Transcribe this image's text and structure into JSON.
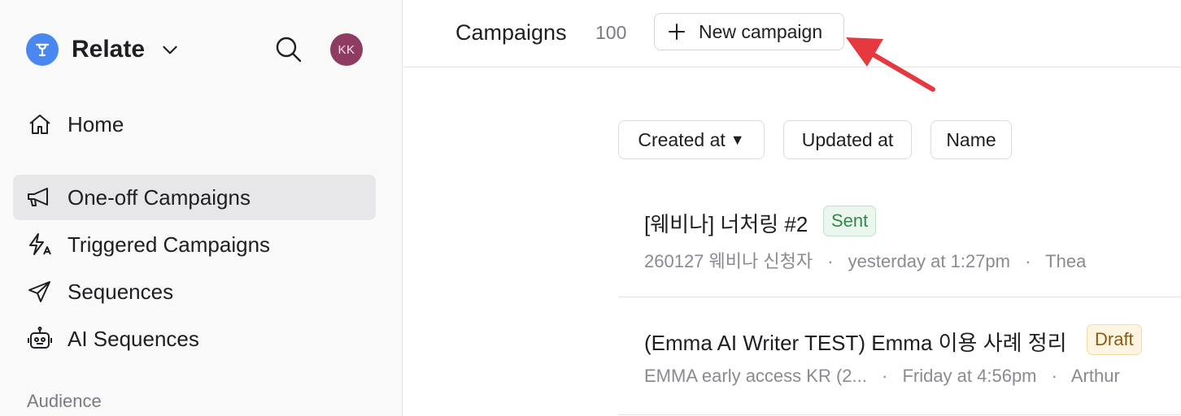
{
  "workspace": {
    "name": "Relate",
    "logo_color": "#4b87f0"
  },
  "user": {
    "initials": "KK",
    "avatar_color": "#8f3c63"
  },
  "sidebar": {
    "items": [
      {
        "label": "Home",
        "icon": "home-icon",
        "active": false
      },
      {
        "label": "One-off Campaigns",
        "icon": "megaphone-icon",
        "active": true
      },
      {
        "label": "Triggered Campaigns",
        "icon": "bolt-icon",
        "active": false
      },
      {
        "label": "Sequences",
        "icon": "paper-plane-icon",
        "active": false
      },
      {
        "label": "AI Sequences",
        "icon": "robot-icon",
        "active": false
      }
    ],
    "section_label": "Audience"
  },
  "header": {
    "title": "Campaigns",
    "count": "100",
    "new_button_label": "New campaign"
  },
  "sort": {
    "created": "Created at",
    "created_arrow": "▼",
    "updated": "Updated at",
    "name": "Name"
  },
  "campaigns": [
    {
      "title": "[웨비나] 너처링 #2",
      "status": "Sent",
      "audience": "260127 웨비나 신청자",
      "time": "yesterday at 1:27pm",
      "owner": "Thea"
    },
    {
      "title": "(Emma AI Writer TEST) Emma 이용 사례 정리",
      "status": "Draft",
      "audience": "EMMA early access KR (2...",
      "time": "Friday at 4:56pm",
      "owner": "Arthur"
    }
  ],
  "separator": "·",
  "colors": {
    "accent_arrow": "#e5393f",
    "active_bg": "#e7e7ea"
  }
}
